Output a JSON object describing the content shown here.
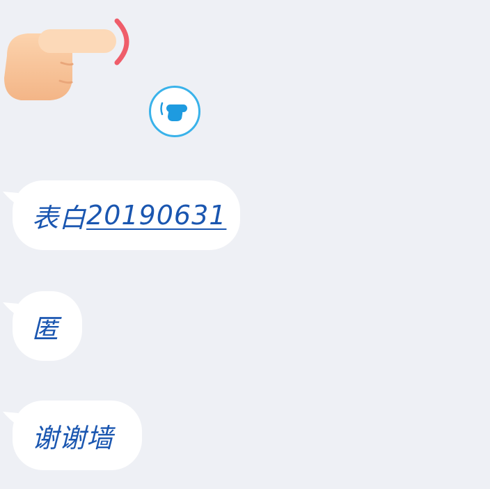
{
  "reaction": {
    "emoji_icon": "pointing-hand-icon",
    "button_icon": "pointing-hand-icon",
    "accent": "#39b2ea"
  },
  "messages": [
    {
      "prefix": "表白",
      "link": "20190631"
    },
    {
      "text": "匿"
    },
    {
      "text": "谢谢墙"
    }
  ],
  "colors": {
    "text": "#1a56b0",
    "bubble": "#ffffff",
    "background": "#eef0f5"
  }
}
